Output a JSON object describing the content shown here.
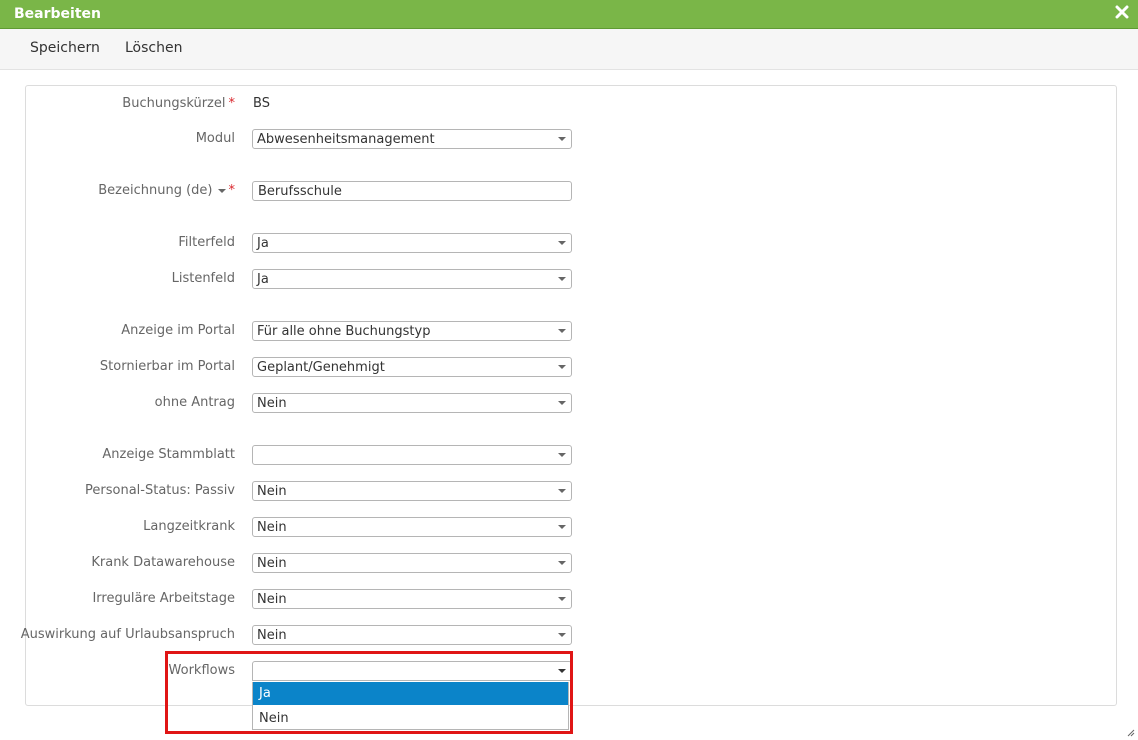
{
  "dialog": {
    "title": "Bearbeiten"
  },
  "toolbar": {
    "save_label": "Speichern",
    "delete_label": "Löschen"
  },
  "form": {
    "buchungskuerzel": {
      "label": "Buchungskürzel",
      "required_mark": "*",
      "value": "BS"
    },
    "modul": {
      "label": "Modul",
      "value": "Abwesenheitsmanagement"
    },
    "bezeichnung": {
      "label": "Bezeichnung (de)",
      "required_mark": "*",
      "value": "Berufsschule"
    },
    "filterfeld": {
      "label": "Filterfeld",
      "value": "Ja"
    },
    "listenfeld": {
      "label": "Listenfeld",
      "value": "Ja"
    },
    "anzeige_portal": {
      "label": "Anzeige im Portal",
      "value": "Für alle ohne Buchungstyp"
    },
    "stornierbar_portal": {
      "label": "Stornierbar im Portal",
      "value": "Geplant/Genehmigt"
    },
    "ohne_antrag": {
      "label": "ohne Antrag",
      "value": "Nein"
    },
    "anzeige_stammblatt": {
      "label": "Anzeige Stammblatt",
      "value": ""
    },
    "personal_status": {
      "label": "Personal-Status: Passiv",
      "value": "Nein"
    },
    "langzeitkrank": {
      "label": "Langzeitkrank",
      "value": "Nein"
    },
    "krank_dwh": {
      "label": "Krank Datawarehouse",
      "value": "Nein"
    },
    "irregulaere": {
      "label": "Irreguläre Arbeitstage",
      "value": "Nein"
    },
    "auswirkung": {
      "label": "Auswirkung auf Urlaubsanspruch",
      "value": "Nein"
    },
    "workflows": {
      "label": "Workflows",
      "value": "",
      "options": [
        "Ja",
        "Nein"
      ],
      "highlighted_option": "Ja"
    }
  },
  "colors": {
    "titlebar": "#7ab648",
    "selected_option": "#0b84c9",
    "required": "#d9262c",
    "highlight_box": "#e01515"
  },
  "icons": {
    "close": "close-icon",
    "resize": "resize-handle-icon"
  }
}
